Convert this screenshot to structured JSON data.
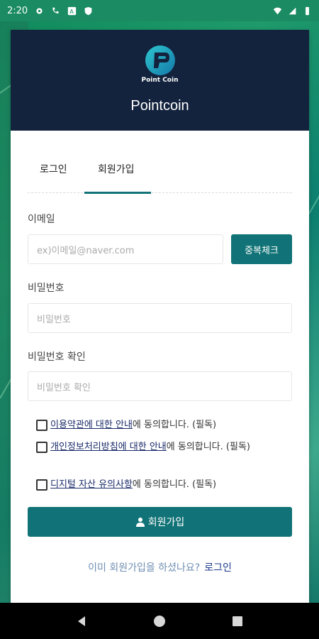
{
  "status_bar": {
    "time": "2:20",
    "left_icons": [
      "settings-icon",
      "phone-icon",
      "text-a-icon",
      "shield-icon"
    ],
    "right_icons": [
      "wifi-icon",
      "signal-icon",
      "battery-icon"
    ]
  },
  "header": {
    "logo_text": "Point Coin",
    "app_title": "Pointcoin"
  },
  "tabs": {
    "login": "로그인",
    "signup": "회원가입",
    "active": "signup"
  },
  "form": {
    "email_label": "이메일",
    "email_placeholder": "ex)이메일@naver.com",
    "duplicate_check": "중복체크",
    "password_label": "비밀번호",
    "password_placeholder": "비밀번호",
    "password_confirm_label": "비밀번호 확인",
    "password_confirm_placeholder": "비밀번호 확인"
  },
  "agreements": [
    {
      "link": "이용약관에 대한 안내",
      "suffix": "에 동의합니다. (필독)"
    },
    {
      "link": "개인정보처리방침에 대한 안내",
      "suffix": "에 동의합니다. (필독)"
    },
    {
      "link": "디지털 자산 유의사항",
      "suffix": "에 동의합니다. (필독)"
    }
  ],
  "submit_label": "회원가입",
  "footer": {
    "question": "이미 회원가입을 하셨나요?",
    "login_link": "로그인"
  },
  "colors": {
    "header_bg": "#13233d",
    "accent": "#117377",
    "link": "#1a2b6a"
  }
}
